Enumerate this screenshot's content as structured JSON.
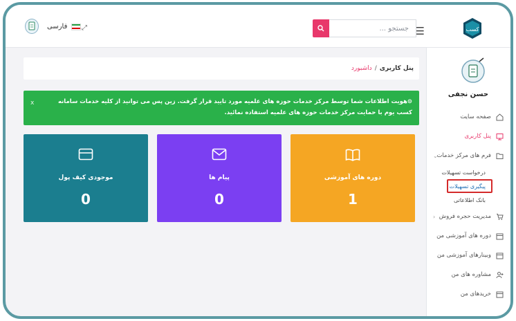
{
  "header": {
    "search_placeholder": "جستجو ...",
    "language": "فارسی"
  },
  "colors": {
    "accent": "#e8386b",
    "alert_green": "#2ab14a",
    "card_orange": "#f5a623",
    "card_purple": "#7b3ff2",
    "card_teal": "#1b7e8f",
    "highlight_border": "#d42a2a"
  },
  "sidebar": {
    "user_name": "حسن نجفی",
    "items": [
      {
        "label": "صفحه سایت",
        "icon": "home-icon"
      },
      {
        "label": "پنل کاربری",
        "icon": "monitor-icon"
      },
      {
        "label": "فرم های مرکز خدمات",
        "icon": "folder-icon"
      },
      {
        "label": "مدیریت حجره فروش",
        "icon": "cart-icon"
      },
      {
        "label": "دوره های آموزشی من",
        "icon": "calendar-icon"
      },
      {
        "label": "وبینارهای آموزشی من",
        "icon": "calendar-icon"
      },
      {
        "label": "مشاوره های من",
        "icon": "user-plus-icon"
      },
      {
        "label": "خریدهای من",
        "icon": "calendar-icon"
      }
    ],
    "submenu": [
      {
        "label": "درخواست تسهیلات"
      },
      {
        "label": "پیگیری تسهیلات"
      },
      {
        "label": "بانک اطلاعاتی"
      }
    ]
  },
  "breadcrumb": {
    "root": "پنل کاربری",
    "separator": "/",
    "current": "داشبورد"
  },
  "alert": {
    "text": "⊙هویت اطلاعات شما توسط مرکز خدمات حوزه های علمیه مورد تایید قرار گرفت. زین پس می توانید از کلیه خدمات سامانه کسب یوم با حمایت مرکز خدمات حوزه های علمیه استفاده نمائید.",
    "close": "x"
  },
  "stats": [
    {
      "label": "دوره های آموزشی",
      "value": "1",
      "icon": "book-icon"
    },
    {
      "label": "پیام ها",
      "value": "0",
      "icon": "mail-icon"
    },
    {
      "label": "موجودی کیف پول",
      "value": "0",
      "icon": "wallet-icon"
    }
  ]
}
